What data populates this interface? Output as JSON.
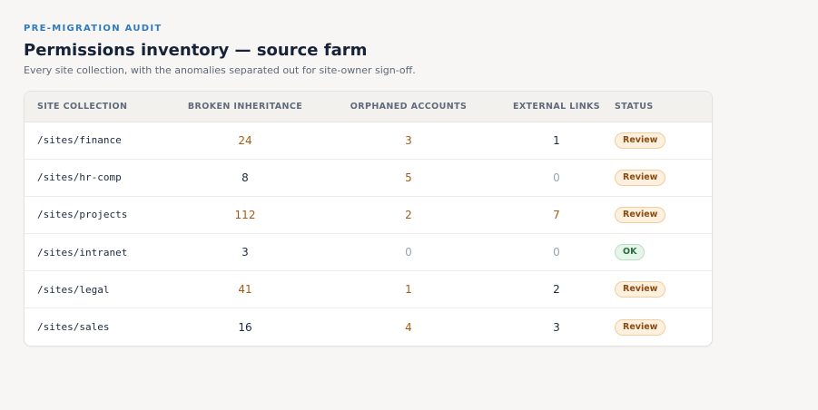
{
  "header": {
    "eyebrow": "PRE-MIGRATION AUDIT",
    "title": "Permissions inventory — source farm",
    "subtitle": "Every site collection, with the anomalies separated out for site-owner sign-off."
  },
  "table": {
    "columns": [
      "SITE COLLECTION",
      "BROKEN INHERITANCE",
      "ORPHANED ACCOUNTS",
      "EXTERNAL LINKS",
      "STATUS"
    ],
    "rows": [
      {
        "site": "/sites/finance",
        "broken": "24",
        "orphaned": "3",
        "external": "1",
        "status": "Review"
      },
      {
        "site": "/sites/hr-comp",
        "broken": "8",
        "orphaned": "5",
        "external": "0",
        "status": "Review"
      },
      {
        "site": "/sites/projects",
        "broken": "112",
        "orphaned": "2",
        "external": "7",
        "status": "Review"
      },
      {
        "site": "/sites/intranet",
        "broken": "3",
        "orphaned": "0",
        "external": "0",
        "status": "OK"
      },
      {
        "site": "/sites/legal",
        "broken": "41",
        "orphaned": "1",
        "external": "2",
        "status": "Review"
      },
      {
        "site": "/sites/sales",
        "broken": "16",
        "orphaned": "4",
        "external": "3",
        "status": "Review"
      }
    ]
  },
  "colors": {
    "accent": "#2f7bbd",
    "warning_text": "#a45a12",
    "zero_text": "#9aa3ae",
    "review_badge_bg": "#fdf0de",
    "ok_badge_bg": "#e6f4ea"
  }
}
